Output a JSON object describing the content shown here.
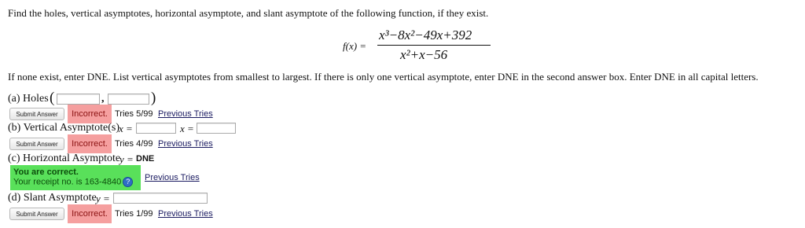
{
  "question": "Find the holes, vertical asymptotes, horizontal asymptote, and slant asymptote of the following function, if they exist.",
  "function": {
    "lhs": "f(x) =",
    "numerator": "x³−8x²−49x+392",
    "denominator": "x²+x−56"
  },
  "instructions": "If none exist, enter DNE. List vertical asymptotes from smallest to largest. If there is only one vertical asymptote, enter DNE in the second answer box. Enter DNE in all capital letters.",
  "parts": {
    "a": {
      "label": "(a) Holes",
      "open_paren": "(",
      "comma": ",",
      "close_paren": ")",
      "submit": "Submit Answer",
      "status": "Incorrect.",
      "tries": "Tries 5/99",
      "previous": "Previous Tries"
    },
    "b": {
      "label": "(b) Vertical Asymptote(s)",
      "x_eq_1": "x =",
      "x_eq_2": "x =",
      "submit": "Submit Answer",
      "status": "Incorrect.",
      "tries": "Tries 4/99",
      "previous": "Previous Tries"
    },
    "c": {
      "label": "(c) Horizontal Asymptote",
      "y_eq": "y =",
      "value": "DNE",
      "correct_line1": "You are correct.",
      "correct_line2": "Your receipt no. is 163-4840",
      "help_icon": "?",
      "previous": "Previous Tries"
    },
    "d": {
      "label": "(d) Slant Asymptote",
      "y_eq": "y =",
      "submit": "Submit Answer",
      "status": "Incorrect.",
      "tries": "Tries 1/99",
      "previous": "Previous Tries"
    }
  }
}
